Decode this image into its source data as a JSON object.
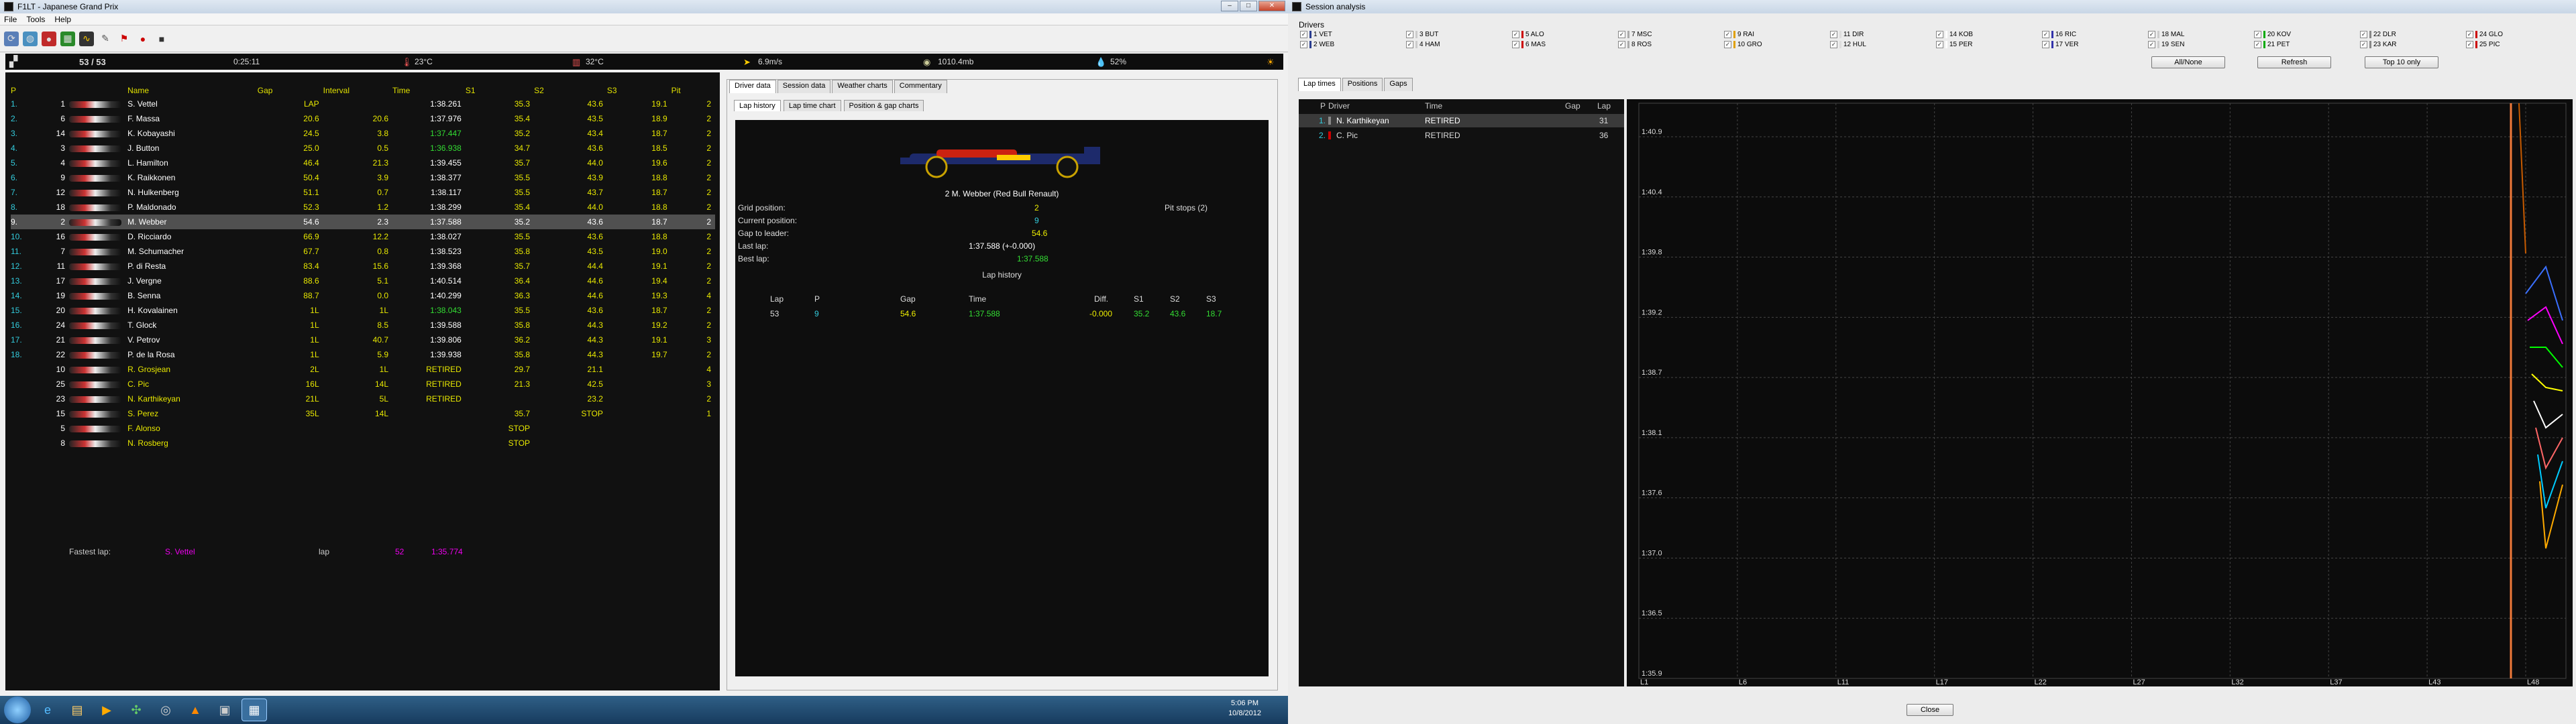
{
  "main_window": {
    "title": "F1LT - Japanese Grand Prix",
    "menu": [
      "File",
      "Tools",
      "Help"
    ]
  },
  "status": {
    "laps": "53 / 53",
    "time": "0:25:11",
    "air_temp": "23°C",
    "track_temp": "32°C",
    "wind": "6.9m/s",
    "pressure": "1010.4mb",
    "humidity": "52%"
  },
  "race": {
    "headers": [
      "P",
      "",
      "Name",
      "Gap",
      "Interval",
      "Time",
      "S1",
      "S2",
      "S3",
      "Pit"
    ],
    "rows": [
      [
        "1.",
        "1",
        "S. Vettel",
        "LAP",
        "",
        "1:38.261",
        "35.3",
        "43.6",
        "19.1",
        "2"
      ],
      [
        "2.",
        "6",
        "F. Massa",
        "20.6",
        "20.6",
        "1:37.976",
        "35.4",
        "43.5",
        "18.9",
        "2"
      ],
      [
        "3.",
        "14",
        "K. Kobayashi",
        "24.5",
        "3.8",
        "1:37.447",
        "35.2",
        "43.4",
        "18.7",
        "2"
      ],
      [
        "4.",
        "3",
        "J. Button",
        "25.0",
        "0.5",
        "1:36.938",
        "34.7",
        "43.6",
        "18.5",
        "2"
      ],
      [
        "5.",
        "4",
        "L. Hamilton",
        "46.4",
        "21.3",
        "1:39.455",
        "35.7",
        "44.0",
        "19.6",
        "2"
      ],
      [
        "6.",
        "9",
        "K. Raikkonen",
        "50.4",
        "3.9",
        "1:38.377",
        "35.5",
        "43.9",
        "18.8",
        "2"
      ],
      [
        "7.",
        "12",
        "N. Hulkenberg",
        "51.1",
        "0.7",
        "1:38.117",
        "35.5",
        "43.7",
        "18.7",
        "2"
      ],
      [
        "8.",
        "18",
        "P. Maldonado",
        "52.3",
        "1.2",
        "1:38.299",
        "35.4",
        "44.0",
        "18.8",
        "2"
      ],
      [
        "9.",
        "2",
        "M. Webber",
        "54.6",
        "2.3",
        "1:37.588",
        "35.2",
        "43.6",
        "18.7",
        "2"
      ],
      [
        "10.",
        "16",
        "D. Ricciardo",
        "66.9",
        "12.2",
        "1:38.027",
        "35.5",
        "43.6",
        "18.8",
        "2"
      ],
      [
        "11.",
        "7",
        "M. Schumacher",
        "67.7",
        "0.8",
        "1:38.523",
        "35.8",
        "43.5",
        "19.0",
        "2"
      ],
      [
        "12.",
        "11",
        "P. di Resta",
        "83.4",
        "15.6",
        "1:39.368",
        "35.7",
        "44.4",
        "19.1",
        "2"
      ],
      [
        "13.",
        "17",
        "J. Vergne",
        "88.6",
        "5.1",
        "1:40.514",
        "36.4",
        "44.6",
        "19.4",
        "2"
      ],
      [
        "14.",
        "19",
        "B. Senna",
        "88.7",
        "0.0",
        "1:40.299",
        "36.3",
        "44.6",
        "19.3",
        "4"
      ],
      [
        "15.",
        "20",
        "H. Kovalainen",
        "1L",
        "1L",
        "1:38.043",
        "35.5",
        "43.6",
        "18.7",
        "2"
      ],
      [
        "16.",
        "24",
        "T. Glock",
        "1L",
        "8.5",
        "1:39.588",
        "35.8",
        "44.3",
        "19.2",
        "2"
      ],
      [
        "17.",
        "21",
        "V. Petrov",
        "1L",
        "40.7",
        "1:39.806",
        "36.2",
        "44.3",
        "19.1",
        "3"
      ],
      [
        "18.",
        "22",
        "P. de la Rosa",
        "1L",
        "5.9",
        "1:39.938",
        "35.8",
        "44.3",
        "19.7",
        "2"
      ],
      [
        "",
        "10",
        "R. Grosjean",
        "2L",
        "1L",
        "RETIRED",
        "29.7",
        "21.1",
        "",
        "4"
      ],
      [
        "",
        "25",
        "C. Pic",
        "16L",
        "14L",
        "RETIRED",
        "21.3",
        "42.5",
        "",
        "3"
      ],
      [
        "",
        "23",
        "N. Karthikeyan",
        "21L",
        "5L",
        "RETIRED",
        "",
        "23.2",
        "",
        "2"
      ],
      [
        "",
        "15",
        "S. Perez",
        "35L",
        "14L",
        "",
        "35.7",
        "STOP",
        "",
        "1"
      ],
      [
        "",
        "5",
        "F. Alonso",
        "",
        "",
        "",
        "STOP",
        "",
        "",
        ""
      ],
      [
        "",
        "8",
        "N. Rosberg",
        "",
        "",
        "",
        "STOP",
        "",
        "",
        ""
      ]
    ],
    "fastest": {
      "label": "Fastest lap:",
      "driver": "S. Vettel",
      "lap_label": "lap",
      "lap": "52",
      "time": "1:35.774"
    }
  },
  "center": {
    "tabs": [
      "Driver data",
      "Session data",
      "Weather charts",
      "Commentary"
    ],
    "subtabs": [
      "Lap history",
      "Lap time chart",
      "Position & gap charts"
    ],
    "driver_title": "2  M. Webber (Red Bull Renault)",
    "grid_label": "Grid position:",
    "grid": "2",
    "current_label": "Current position:",
    "current": "9",
    "gap_label": "Gap to leader:",
    "gap": "54.6",
    "last_label": "Last lap:",
    "last": "1:37.588 (+-0.000)",
    "best_label": "Best lap:",
    "best": "1:37.588",
    "pits": "Pit stops (2)",
    "history_title": "Lap history",
    "history_headers": [
      "Lap",
      "P",
      "Gap",
      "Time",
      "Diff.",
      "S1",
      "S2",
      "S3"
    ],
    "history_row": [
      "53",
      "9",
      "54.6",
      "1:37.588",
      "-0.000",
      "35.2",
      "43.6",
      "18.7"
    ]
  },
  "analysis": {
    "title": "Session analysis",
    "drivers_label": "Drivers",
    "drivers": [
      [
        "1 VET",
        "#2a3d8f"
      ],
      [
        "2 WEB",
        "#2a3d8f"
      ],
      [
        "3 BUT",
        "#ccc"
      ],
      [
        "4 HAM",
        "#ccc"
      ],
      [
        "5 ALO",
        "#c00"
      ],
      [
        "6 MAS",
        "#c00"
      ],
      [
        "7 MSC",
        "#aaa"
      ],
      [
        "8 ROS",
        "#aaa"
      ],
      [
        "9 RAI",
        "#e0a000"
      ],
      [
        "10 GRO",
        "#e0a000"
      ],
      [
        "11 DIR",
        "#ddd"
      ],
      [
        "12 HUL",
        "#ddd"
      ],
      [
        "14 KOB",
        "#fff"
      ],
      [
        "15 PER",
        "#fff"
      ],
      [
        "16 RIC",
        "#33a"
      ],
      [
        "17 VER",
        "#33a"
      ],
      [
        "18 MAL",
        "#ccc"
      ],
      [
        "19 SEN",
        "#ccc"
      ],
      [
        "20 KOV",
        "#0a0"
      ],
      [
        "21 PET",
        "#0a0"
      ],
      [
        "22 DLR",
        "#888"
      ],
      [
        "23 KAR",
        "#888"
      ],
      [
        "24 GLO",
        "#c00"
      ],
      [
        "25 PIC",
        "#c00"
      ]
    ],
    "buttons": [
      "All/None",
      "Refresh",
      "Top 10 only"
    ],
    "tabs": [
      "Lap times",
      "Positions",
      "Gaps"
    ],
    "table_headers": [
      "P",
      "Driver",
      "Time",
      "Gap",
      "Lap"
    ],
    "table_rows": [
      [
        "1.",
        "N. Karthikeyan",
        "RETIRED",
        "",
        "31"
      ],
      [
        "2.",
        "C. Pic",
        "RETIRED",
        "",
        "36"
      ]
    ],
    "close": "Close"
  },
  "chart_data": {
    "type": "line",
    "title": "",
    "xlabel": "",
    "ylabel": "",
    "x_ticks": [
      "L1",
      "L6",
      "L11",
      "L17",
      "L22",
      "L27",
      "L32",
      "L37",
      "L43",
      "L48"
    ],
    "y_ticks": [
      "1:40.9",
      "1:40.4",
      "1:39.8",
      "1:39.2",
      "1:38.7",
      "1:38.1",
      "1:37.6",
      "1:37.0",
      "1:36.5",
      "1:35.9"
    ],
    "grid": true
  },
  "taskbar": {
    "time": "5:06 PM",
    "date": "10/8/2012"
  }
}
